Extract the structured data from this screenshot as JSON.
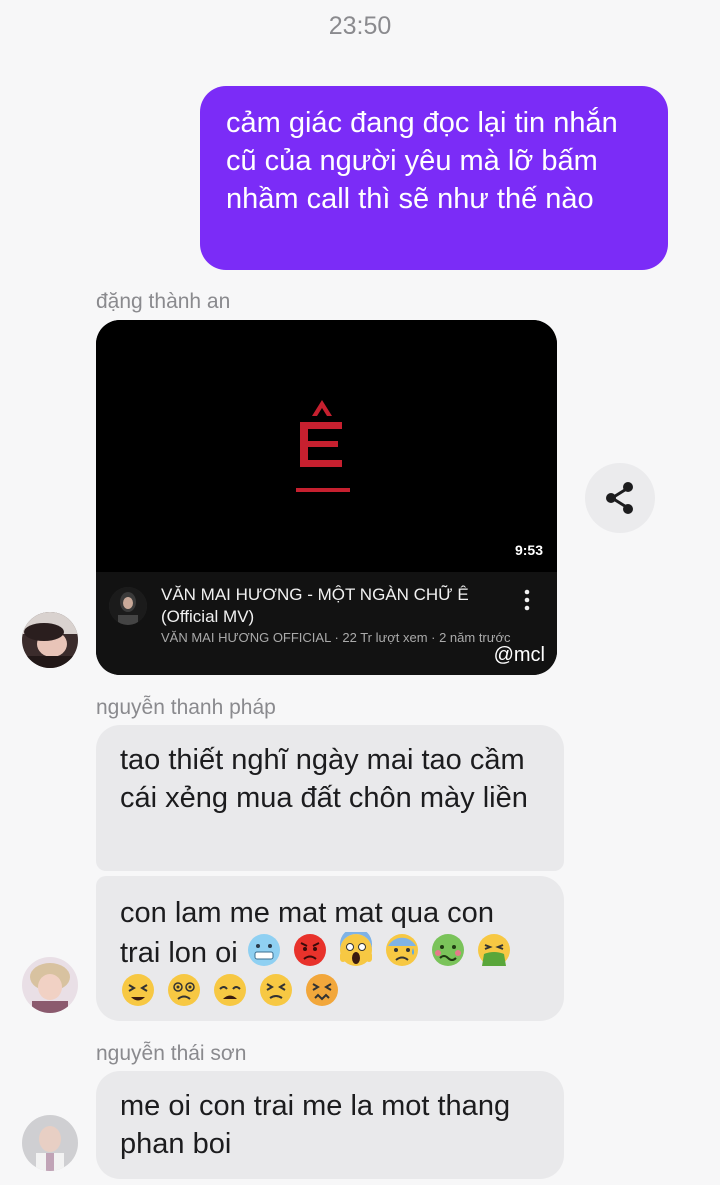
{
  "status": {
    "time": "23:50"
  },
  "messages": {
    "outgoing": {
      "text": "cảm giác đang đọc lại tin nhắn cũ của người yêu mà lỡ bấm nhầm call thì sẽ như thế nào"
    },
    "sender1": {
      "name": "đặng thành an"
    },
    "video": {
      "thumb_letter": "Ê",
      "duration": "9:53",
      "title": "VĂN MAI HƯƠNG - MỘT NGÀN CHỮ Ê (Official MV)",
      "meta": "VĂN MAI HƯƠNG OFFICIAL · 22 Tr lượt xem · 2 năm trước",
      "watermark": "@mcl",
      "accent_color": "#c6202f"
    },
    "sender2": {
      "name": "nguyễn thanh pháp"
    },
    "bubble2": {
      "text": "tao thiết nghĩ ngày mai tao cầm cái xẻng mua đất chôn mày liền"
    },
    "bubble3": {
      "text": "con lam me mat mat qua con trai lon oi",
      "emojis": [
        "cold-face",
        "angry-face",
        "screaming-face",
        "anxious-face",
        "nauseated-face",
        "vomiting-face",
        "tired-face",
        "dizzy-face",
        "weary-face",
        "persevering-face",
        "confounded-face"
      ]
    },
    "sender3": {
      "name": "nguyễn thái sơn"
    },
    "bubble4": {
      "text": "me oi con trai me la mot thang phan boi"
    }
  },
  "colors": {
    "outgoing_bubble": "#7b2cf7",
    "incoming_bubble": "#e9e9eb",
    "background": "#f7f7f8"
  }
}
